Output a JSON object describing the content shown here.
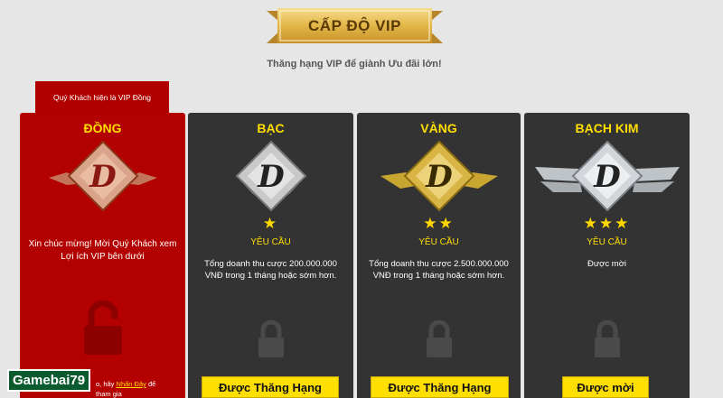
{
  "header": {
    "title": "CẤP ĐỘ VIP",
    "subtitle": "Thăng hạng VIP để giành Ưu đãi lớn!"
  },
  "current_tier_tab": "Quý Khách hiện là VIP Đồng",
  "tiers": [
    {
      "name": "ĐỒNG",
      "congrats": "Xin chúc mừng! Mời Quý Khách xem Lợi ích VIP bên dưới",
      "bottom_note_prefix": "o, hãy",
      "bottom_note_link": "Nhấn Đây",
      "bottom_note_suffix": "để",
      "bottom_note_line2": "tham gia"
    },
    {
      "name": "BẠC",
      "stars": "★",
      "requirement_label": "YÊU CẦU",
      "requirement_text": "Tổng doanh thu cược 200.000.000 VNĐ trong 1 tháng hoặc sớm hơn.",
      "button_label": "Được Thăng Hạng"
    },
    {
      "name": "VÀNG",
      "stars": "★★",
      "requirement_label": "YÊU CẦU",
      "requirement_text": "Tổng doanh thu cược 2.500.000.000 VNĐ trong 1 tháng hoặc sớm hơn.",
      "button_label": "Được Thăng Hạng"
    },
    {
      "name": "BẠCH KIM",
      "stars": "★★★",
      "requirement_label": "YÊU CẦU",
      "requirement_text": "Được mời",
      "button_label": "Được mời"
    }
  ],
  "watermark": "Gamebai79",
  "colors": {
    "page_bg": "#e6e6e6",
    "active_card": "#b30000",
    "inactive_card": "#333333",
    "accent_yellow": "#ffde00",
    "ribbon_gold": "#e8bd55"
  },
  "icons": {
    "tier_badge": "diamond-d-badge-icon",
    "lock": "padlock-icon",
    "star": "star-icon"
  }
}
